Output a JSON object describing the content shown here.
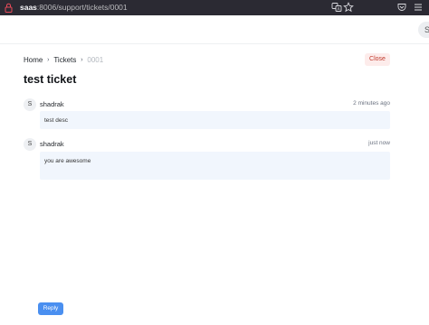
{
  "browser": {
    "url_host": "saas",
    "url_rest": ":8006/support/tickets/0001",
    "icons": [
      "lock-icon",
      "translate-icon",
      "bookmark-star-icon",
      "pocket-icon",
      "menu-icon"
    ]
  },
  "topbar": {
    "user_initial": "S"
  },
  "breadcrumb": {
    "items": [
      "Home",
      "Tickets",
      "0001"
    ],
    "separator": "›"
  },
  "close_label": "Close",
  "ticket": {
    "title": "test ticket"
  },
  "comments": [
    {
      "avatar": "S",
      "author": "shadrak",
      "time": "2 minutes ago",
      "body": "test desc"
    },
    {
      "avatar": "S",
      "author": "shadrak",
      "time": "just now",
      "body": "you are awesome"
    }
  ],
  "reply_label": "Reply",
  "colors": {
    "chrome_bg": "#2b2a33",
    "bubble_bg": "#f1f6fd",
    "primary": "#4a8ff0",
    "danger": "#c0392b",
    "danger_bg": "#fdeceb"
  }
}
